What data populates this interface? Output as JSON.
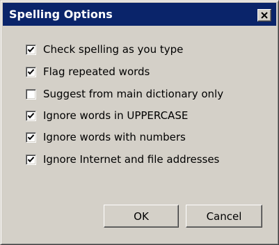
{
  "dialog": {
    "title": "Spelling Options",
    "close_icon": "close-x-icon"
  },
  "options": [
    {
      "label": "Check spelling as you type",
      "checked": true
    },
    {
      "label": "Flag repeated words",
      "checked": true
    },
    {
      "label": "Suggest from main dictionary only",
      "checked": false
    },
    {
      "label": "Ignore words in UPPERCASE",
      "checked": true
    },
    {
      "label": "Ignore words with numbers",
      "checked": true
    },
    {
      "label": "Ignore Internet and file addresses",
      "checked": true
    }
  ],
  "buttons": {
    "ok_label": "OK",
    "cancel_label": "Cancel"
  },
  "colors": {
    "titlebar": "#0a246a",
    "face": "#d4d0c8"
  }
}
